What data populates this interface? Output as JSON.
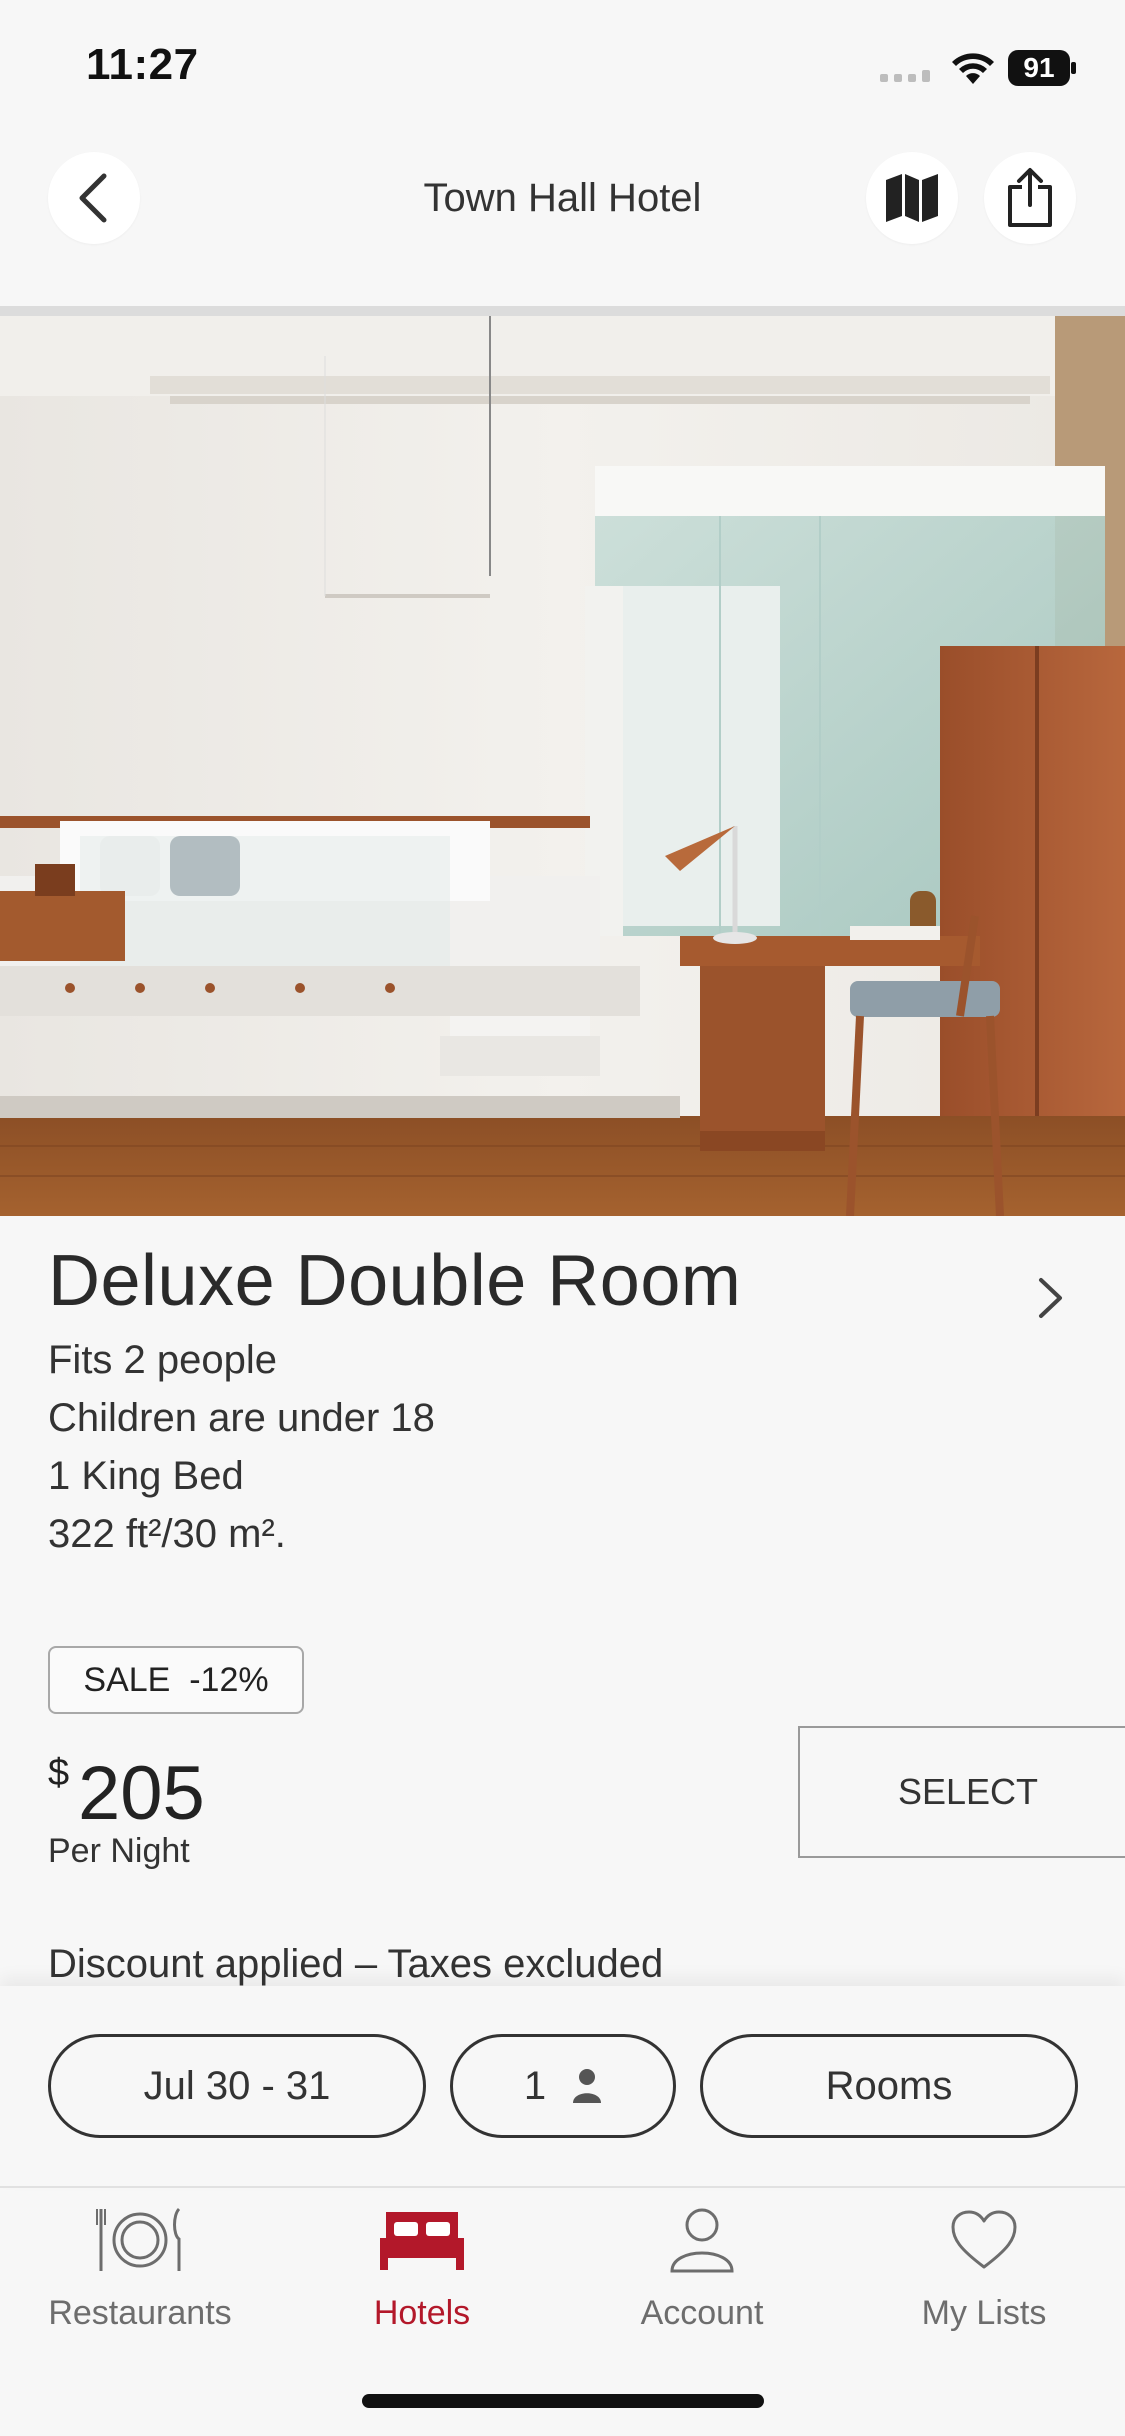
{
  "status_bar": {
    "time": "11:27",
    "battery": "91"
  },
  "header": {
    "title": "Town Hall Hotel",
    "icons": [
      "chevron-left-icon",
      "map-icon",
      "share-icon"
    ]
  },
  "room": {
    "name": "Deluxe Double Room",
    "details": [
      "Fits 2 people",
      "Children are under 18",
      "1 King Bed",
      "322 ft²/30 m²."
    ],
    "sale_badge": "SALE  -12%",
    "currency": "$",
    "price": "205",
    "price_unit": "Per Night",
    "select_label": "SELECT",
    "discount_note": "Discount applied – Taxes excluded"
  },
  "booking": {
    "dates": "Jul 30 - 31",
    "guests": "1",
    "rooms": "Rooms"
  },
  "tabs": [
    {
      "label": "Restaurants",
      "icon": "plate-icon",
      "active": false
    },
    {
      "label": "Hotels",
      "icon": "bed-icon",
      "active": true
    },
    {
      "label": "Account",
      "icon": "person-icon",
      "active": false
    },
    {
      "label": "My Lists",
      "icon": "heart-icon",
      "active": false
    }
  ],
  "colors": {
    "accent": "#b3182a",
    "background": "#f7f7f7",
    "text": "#2b2b2b"
  }
}
